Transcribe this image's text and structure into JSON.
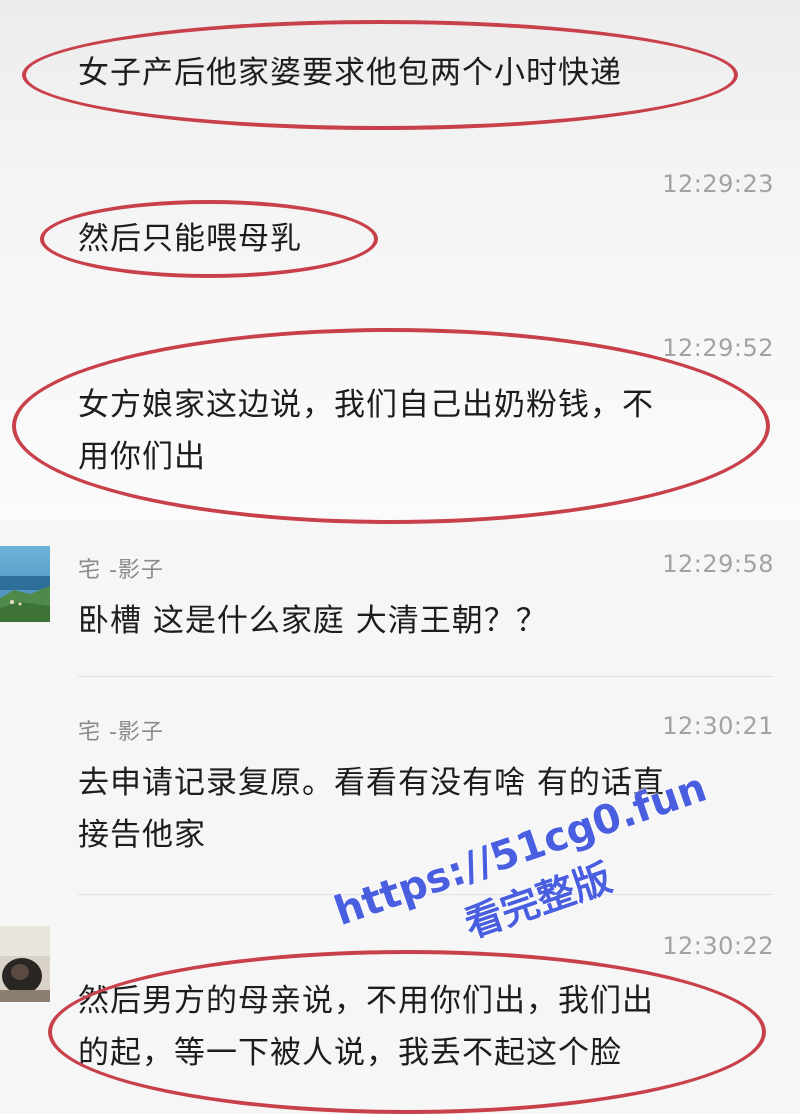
{
  "messages": [
    {
      "text": "女子产后他家婆要求他包两个小时快递"
    },
    {
      "time": "12:29:23",
      "text": "然后只能喂母乳"
    },
    {
      "time": "12:29:52",
      "line1": "女方娘家这边说，我们自己出奶粉钱，不",
      "line2": "用你们出"
    },
    {
      "sender": "宅 -影子",
      "time": "12:29:58",
      "text": "卧槽 这是什么家庭  大清王朝？？"
    },
    {
      "sender": "宅 -影子",
      "time": "12:30:21",
      "line1": "去申请记录复原。看看有没有啥 有的话直",
      "line2": "接告他家"
    },
    {
      "time": "12:30:22",
      "line1": "然后男方的母亲说，不用你们出，我们出",
      "line2": "的起，等一下被人说，我丢不起这个脸"
    }
  ],
  "watermark": {
    "url": "https://51cg0.fun",
    "subtitle": "看完整版"
  },
  "colors": {
    "annotation_circle": "#c8404a",
    "watermark": "#4a5ee0",
    "timestamp": "#a2a2a2"
  }
}
